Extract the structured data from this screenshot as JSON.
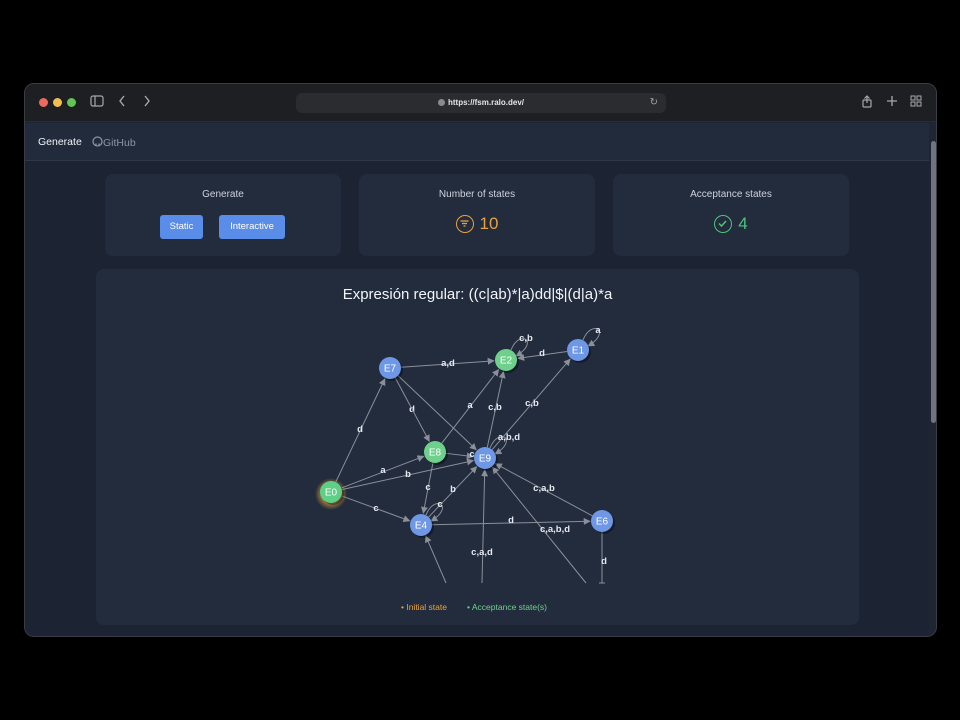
{
  "browser": {
    "url": "https://fsm.ralo.dev/",
    "traffic_lights": [
      "#ed6a5e",
      "#f5bf4f",
      "#61c554"
    ]
  },
  "nav": {
    "generate": "Generate",
    "github": "GitHub"
  },
  "cards": {
    "generate": {
      "title": "Generate",
      "static_label": "Static",
      "interactive_label": "Interactive"
    },
    "states": {
      "title": "Number of states",
      "value": "10",
      "icon": "filter-lines-icon",
      "color": "#e9a23b"
    },
    "acceptance": {
      "title": "Acceptance states",
      "value": "4",
      "icon": "check-badge-icon",
      "color": "#4cc47a"
    }
  },
  "graph": {
    "title": "Expresión regular: ((c|ab)*|a)dd|$|(d|a)*a",
    "colors": {
      "initial": "#e9a23b",
      "acceptance": "#6fd08c",
      "normal": "#6e97e6",
      "edge": "#8a8f99"
    },
    "nodes": [
      {
        "id": "E0",
        "type": "initial"
      },
      {
        "id": "E1",
        "type": "normal"
      },
      {
        "id": "E2",
        "type": "acceptance"
      },
      {
        "id": "E4",
        "type": "normal"
      },
      {
        "id": "E6",
        "type": "normal"
      },
      {
        "id": "E7",
        "type": "normal"
      },
      {
        "id": "E8",
        "type": "acceptance"
      },
      {
        "id": "E9",
        "type": "normal"
      }
    ],
    "edge_labels": [
      "a,d",
      "d",
      "a",
      "d",
      "d",
      "c,b",
      "a",
      "c,b",
      "c,b",
      "a,b,d",
      "a",
      "b",
      "c",
      "b",
      "b",
      "c",
      "d",
      "c,a,b",
      "c,a,b,d",
      "c,a,d",
      "d",
      "c"
    ],
    "legend": {
      "initial": "Initial state",
      "acceptance": "Acceptance state(s)"
    }
  }
}
